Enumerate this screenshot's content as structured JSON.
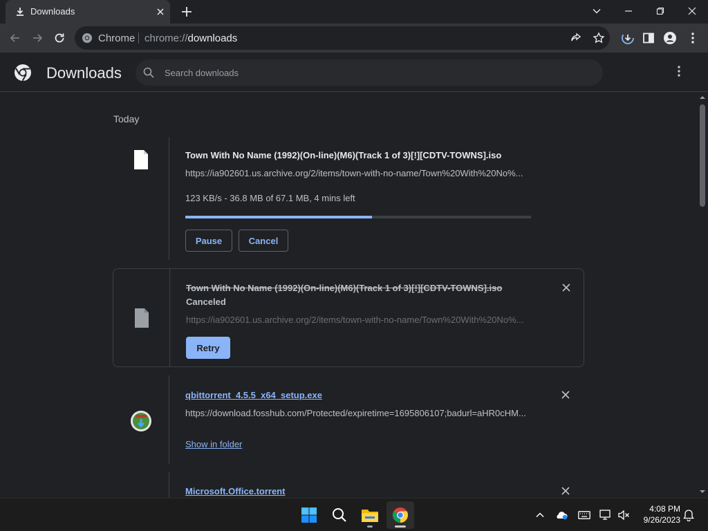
{
  "window": {
    "tab_title": "Downloads",
    "tab_icon": "download-icon"
  },
  "toolbar": {
    "omnibox_site": "Chrome",
    "url_scheme": "chrome://",
    "url_host": "downloads"
  },
  "header": {
    "title": "Downloads",
    "search_placeholder": "Search downloads"
  },
  "sections": {
    "today_label": "Today"
  },
  "downloads": [
    {
      "name": "Town With No Name (1992)(On-line)(M6)(Track 1 of 3)[!][CDTV-TOWNS].iso",
      "url": "https://ia902601.us.archive.org/2/items/town-with-no-name/Town%20With%20No%...",
      "status": "123 KB/s - 36.8 MB of 67.1 MB, 4 mins left",
      "progress_fraction": 0.54,
      "actions": [
        "Pause",
        "Cancel"
      ],
      "state": "in-progress"
    },
    {
      "name": "Town With No Name (1992)(On-line)(M6)(Track 1 of 3)[!][CDTV-TOWNS].iso",
      "status": "Canceled",
      "url": "https://ia902601.us.archive.org/2/items/town-with-no-name/Town%20With%20No%...",
      "actions": [
        "Retry"
      ],
      "state": "canceled"
    },
    {
      "name": "qbittorrent_4.5.5_x64_setup.exe",
      "url": "https://download.fosshub.com/Protected/expiretime=1695806107;badurl=aHR0cHM...",
      "link": "Show in folder",
      "state": "complete"
    },
    {
      "name": "Microsoft.Office.torrent",
      "state": "complete"
    }
  ],
  "taskbar": {
    "time": "4:08 PM",
    "date": "9/26/2023"
  },
  "colors": {
    "accent": "#8ab4f8",
    "background": "#202124",
    "toolbar": "#35363a"
  }
}
